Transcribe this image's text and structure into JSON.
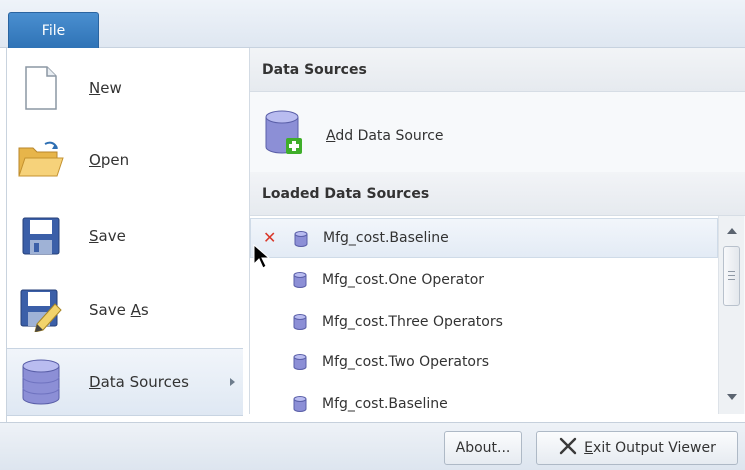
{
  "ribbon": {
    "file_tab": "File"
  },
  "menu": {
    "new": {
      "pre": "",
      "ul": "N",
      "post": "ew"
    },
    "open": {
      "pre": "",
      "ul": "O",
      "post": "pen"
    },
    "save": {
      "pre": "",
      "ul": "S",
      "post": "ave"
    },
    "save_as": {
      "pre": "Save ",
      "ul": "A",
      "post": "s"
    },
    "data_sources": {
      "pre": "",
      "ul": "D",
      "post": "ata Sources"
    }
  },
  "panel": {
    "header": "Data Sources",
    "add_label_ul": "A",
    "add_label_rest": "dd Data Source",
    "loaded_header": "Loaded Data Sources",
    "items": [
      "Mfg_cost.Baseline",
      "Mfg_cost.One Operator",
      "Mfg_cost.Three Operators",
      "Mfg_cost.Two Operators",
      "Mfg_cost.Baseline"
    ]
  },
  "bottom": {
    "about_label": "About...",
    "exit_ul": "E",
    "exit_pre": "",
    "exit_rest": "xit Output Viewer"
  },
  "colors": {
    "accent": "#2f73b6",
    "remove": "#d9382a",
    "add": "#3fae2a"
  }
}
